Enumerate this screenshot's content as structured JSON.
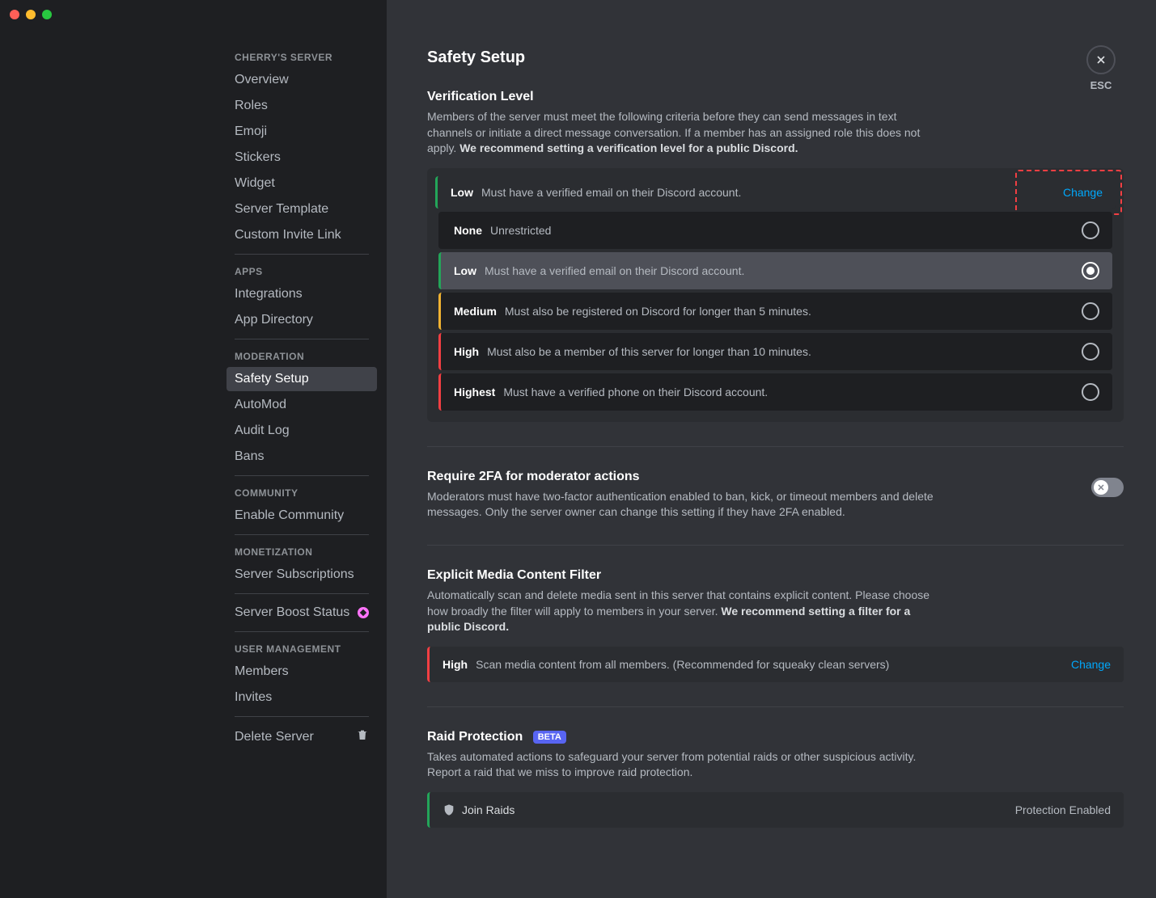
{
  "sidebar": {
    "server_header": "CHERRY'S SERVER",
    "items_server": [
      "Overview",
      "Roles",
      "Emoji",
      "Stickers",
      "Widget",
      "Server Template",
      "Custom Invite Link"
    ],
    "apps_header": "APPS",
    "items_apps": [
      "Integrations",
      "App Directory"
    ],
    "moderation_header": "MODERATION",
    "items_moderation": [
      "Safety Setup",
      "AutoMod",
      "Audit Log",
      "Bans"
    ],
    "community_header": "COMMUNITY",
    "items_community": [
      "Enable Community"
    ],
    "monetization_header": "MONETIZATION",
    "items_monetization": [
      "Server Subscriptions"
    ],
    "boost": "Server Boost Status",
    "user_mgmt_header": "USER MANAGEMENT",
    "items_user": [
      "Members",
      "Invites"
    ],
    "delete": "Delete Server"
  },
  "close": {
    "esc": "ESC"
  },
  "page": {
    "title": "Safety Setup"
  },
  "verification": {
    "title": "Verification Level",
    "desc": "Members of the server must meet the following criteria before they can send messages in text channels or initiate a direct message conversation. If a member has an assigned role this does not apply. ",
    "desc_bold": "We recommend setting a verification level for a public Discord.",
    "current_name": "Low",
    "current_desc": "Must have a verified email on their Discord account.",
    "change": "Change",
    "options": [
      {
        "name": "None",
        "desc": "Unrestricted",
        "class": "none",
        "selected": false
      },
      {
        "name": "Low",
        "desc": "Must have a verified email on their Discord account.",
        "class": "low",
        "selected": true
      },
      {
        "name": "Medium",
        "desc": "Must also be registered on Discord for longer than 5 minutes.",
        "class": "medium",
        "selected": false
      },
      {
        "name": "High",
        "desc": "Must also be a member of this server for longer than 10 minutes.",
        "class": "high",
        "selected": false
      },
      {
        "name": "Highest",
        "desc": "Must have a verified phone on their Discord account.",
        "class": "highest",
        "selected": false
      }
    ]
  },
  "twofa": {
    "title": "Require 2FA for moderator actions",
    "desc": "Moderators must have two-factor authentication enabled to ban, kick, or timeout members and delete messages. Only the server owner can change this setting if they have 2FA enabled.",
    "enabled": false
  },
  "explicit": {
    "title": "Explicit Media Content Filter",
    "desc": "Automatically scan and delete media sent in this server that contains explicit content. Please choose how broadly the filter will apply to members in your server. ",
    "desc_bold": "We recommend setting a filter for a public Discord.",
    "level_name": "High",
    "level_desc": "Scan media content from all members. (Recommended for squeaky clean servers)",
    "change": "Change"
  },
  "raid": {
    "title": "Raid Protection",
    "badge": "BETA",
    "desc": "Takes automated actions to safeguard your server from potential raids or other suspicious activity. Report a raid that we miss to improve raid protection.",
    "row_label": "Join Raids",
    "status": "Protection Enabled"
  }
}
